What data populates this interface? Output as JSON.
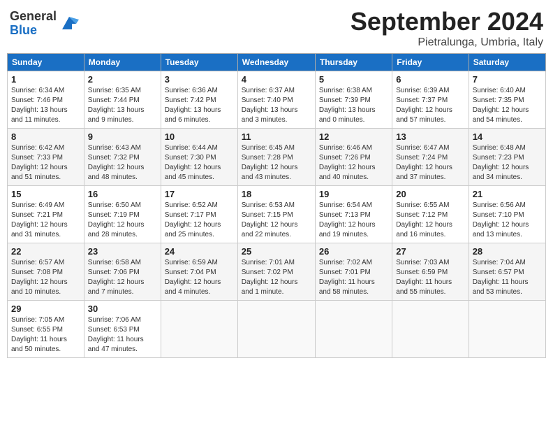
{
  "header": {
    "logo_general": "General",
    "logo_blue": "Blue",
    "month_year": "September 2024",
    "location": "Pietralunga, Umbria, Italy"
  },
  "columns": [
    "Sunday",
    "Monday",
    "Tuesday",
    "Wednesday",
    "Thursday",
    "Friday",
    "Saturday"
  ],
  "weeks": [
    [
      {
        "day": "1",
        "info": "Sunrise: 6:34 AM\nSunset: 7:46 PM\nDaylight: 13 hours\nand 11 minutes."
      },
      {
        "day": "2",
        "info": "Sunrise: 6:35 AM\nSunset: 7:44 PM\nDaylight: 13 hours\nand 9 minutes."
      },
      {
        "day": "3",
        "info": "Sunrise: 6:36 AM\nSunset: 7:42 PM\nDaylight: 13 hours\nand 6 minutes."
      },
      {
        "day": "4",
        "info": "Sunrise: 6:37 AM\nSunset: 7:40 PM\nDaylight: 13 hours\nand 3 minutes."
      },
      {
        "day": "5",
        "info": "Sunrise: 6:38 AM\nSunset: 7:39 PM\nDaylight: 13 hours\nand 0 minutes."
      },
      {
        "day": "6",
        "info": "Sunrise: 6:39 AM\nSunset: 7:37 PM\nDaylight: 12 hours\nand 57 minutes."
      },
      {
        "day": "7",
        "info": "Sunrise: 6:40 AM\nSunset: 7:35 PM\nDaylight: 12 hours\nand 54 minutes."
      }
    ],
    [
      {
        "day": "8",
        "info": "Sunrise: 6:42 AM\nSunset: 7:33 PM\nDaylight: 12 hours\nand 51 minutes."
      },
      {
        "day": "9",
        "info": "Sunrise: 6:43 AM\nSunset: 7:32 PM\nDaylight: 12 hours\nand 48 minutes."
      },
      {
        "day": "10",
        "info": "Sunrise: 6:44 AM\nSunset: 7:30 PM\nDaylight: 12 hours\nand 45 minutes."
      },
      {
        "day": "11",
        "info": "Sunrise: 6:45 AM\nSunset: 7:28 PM\nDaylight: 12 hours\nand 43 minutes."
      },
      {
        "day": "12",
        "info": "Sunrise: 6:46 AM\nSunset: 7:26 PM\nDaylight: 12 hours\nand 40 minutes."
      },
      {
        "day": "13",
        "info": "Sunrise: 6:47 AM\nSunset: 7:24 PM\nDaylight: 12 hours\nand 37 minutes."
      },
      {
        "day": "14",
        "info": "Sunrise: 6:48 AM\nSunset: 7:23 PM\nDaylight: 12 hours\nand 34 minutes."
      }
    ],
    [
      {
        "day": "15",
        "info": "Sunrise: 6:49 AM\nSunset: 7:21 PM\nDaylight: 12 hours\nand 31 minutes."
      },
      {
        "day": "16",
        "info": "Sunrise: 6:50 AM\nSunset: 7:19 PM\nDaylight: 12 hours\nand 28 minutes."
      },
      {
        "day": "17",
        "info": "Sunrise: 6:52 AM\nSunset: 7:17 PM\nDaylight: 12 hours\nand 25 minutes."
      },
      {
        "day": "18",
        "info": "Sunrise: 6:53 AM\nSunset: 7:15 PM\nDaylight: 12 hours\nand 22 minutes."
      },
      {
        "day": "19",
        "info": "Sunrise: 6:54 AM\nSunset: 7:13 PM\nDaylight: 12 hours\nand 19 minutes."
      },
      {
        "day": "20",
        "info": "Sunrise: 6:55 AM\nSunset: 7:12 PM\nDaylight: 12 hours\nand 16 minutes."
      },
      {
        "day": "21",
        "info": "Sunrise: 6:56 AM\nSunset: 7:10 PM\nDaylight: 12 hours\nand 13 minutes."
      }
    ],
    [
      {
        "day": "22",
        "info": "Sunrise: 6:57 AM\nSunset: 7:08 PM\nDaylight: 12 hours\nand 10 minutes."
      },
      {
        "day": "23",
        "info": "Sunrise: 6:58 AM\nSunset: 7:06 PM\nDaylight: 12 hours\nand 7 minutes."
      },
      {
        "day": "24",
        "info": "Sunrise: 6:59 AM\nSunset: 7:04 PM\nDaylight: 12 hours\nand 4 minutes."
      },
      {
        "day": "25",
        "info": "Sunrise: 7:01 AM\nSunset: 7:02 PM\nDaylight: 12 hours\nand 1 minute."
      },
      {
        "day": "26",
        "info": "Sunrise: 7:02 AM\nSunset: 7:01 PM\nDaylight: 11 hours\nand 58 minutes."
      },
      {
        "day": "27",
        "info": "Sunrise: 7:03 AM\nSunset: 6:59 PM\nDaylight: 11 hours\nand 55 minutes."
      },
      {
        "day": "28",
        "info": "Sunrise: 7:04 AM\nSunset: 6:57 PM\nDaylight: 11 hours\nand 53 minutes."
      }
    ],
    [
      {
        "day": "29",
        "info": "Sunrise: 7:05 AM\nSunset: 6:55 PM\nDaylight: 11 hours\nand 50 minutes."
      },
      {
        "day": "30",
        "info": "Sunrise: 7:06 AM\nSunset: 6:53 PM\nDaylight: 11 hours\nand 47 minutes."
      },
      null,
      null,
      null,
      null,
      null
    ]
  ]
}
